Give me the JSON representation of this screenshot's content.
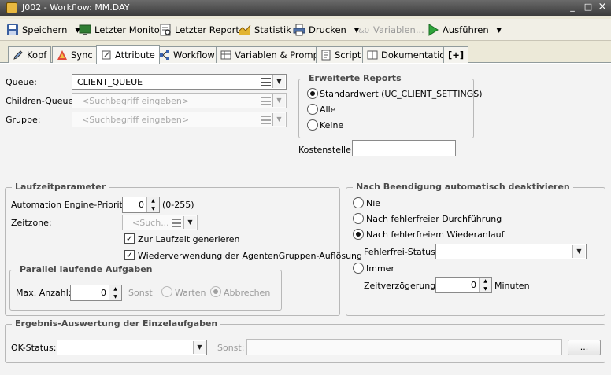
{
  "window": {
    "title": "J002 - Workflow: MM.DAY",
    "minimize": "_",
    "maximize": "□",
    "close": "×"
  },
  "toolbar": {
    "save": "Speichern",
    "last_monitor": "Letzter Monitor",
    "last_report": "Letzter Report",
    "statistic": "Statistik",
    "print": "Drucken",
    "variables": "Variablen...",
    "execute": "Ausführen",
    "dropdown_glyph": "▼"
  },
  "tabs": [
    "Kopf",
    "Sync",
    "Attribute",
    "Workflow",
    "Variablen & Prompts",
    "Script",
    "Dokumentation",
    "[+]"
  ],
  "general": {
    "queue_label": "Queue:",
    "queue_value": "CLIENT_QUEUE",
    "children_queue_label": "Children-Queue:",
    "children_queue_placeholder": "<Suchbegriff eingeben>",
    "group_label": "Gruppe:",
    "group_placeholder": "<Suchbegriff eingeben>"
  },
  "reports": {
    "title": "Erweiterte Reports",
    "options": [
      "Standardwert (UC_CLIENT_SETTINGS)",
      "Alle",
      "Keine"
    ],
    "selected": 0
  },
  "cost": {
    "label": "Kostenstelle:",
    "value": ""
  },
  "runtime": {
    "title": "Laufzeitparameter",
    "priority_label": "Automation Engine-Priorität:",
    "priority_value": "0",
    "priority_range": "(0-255)",
    "timezone_label": "Zeitzone:",
    "timezone_placeholder": "<Such...",
    "generate_at_runtime": "Zur Laufzeit generieren",
    "reuse_agent_groups": "Wiederverwendung der AgentenGruppen-Auflösung",
    "check_glyph": "✓"
  },
  "parallel": {
    "title": "Parallel laufende Aufgaben",
    "max_label": "Max. Anzahl:",
    "max_value": "0",
    "otherwise": "Sonst",
    "wait": "Warten",
    "abort": "Abbrechen"
  },
  "deactivate": {
    "title": "Nach Beendigung automatisch deaktivieren",
    "options": [
      "Nie",
      "Nach fehlerfreier Durchführung",
      "Nach fehlerfreiem Wiederanlauf",
      "Immer"
    ],
    "selected": 2,
    "errorfree_label": "Fehlerfrei-Status:",
    "errorfree_value": "",
    "delay_label": "Zeitverzögerung:",
    "delay_value": "0",
    "delay_unit": "Minuten"
  },
  "evaluation": {
    "title": "Ergebnis-Auswertung der Einzelaufgaben",
    "ok_label": "OK-Status:",
    "ok_value": "",
    "otherwise_label": "Sonst:",
    "otherwise_value": "",
    "browse_button": "..."
  },
  "spinner": {
    "up": "▲",
    "down": "▼"
  }
}
